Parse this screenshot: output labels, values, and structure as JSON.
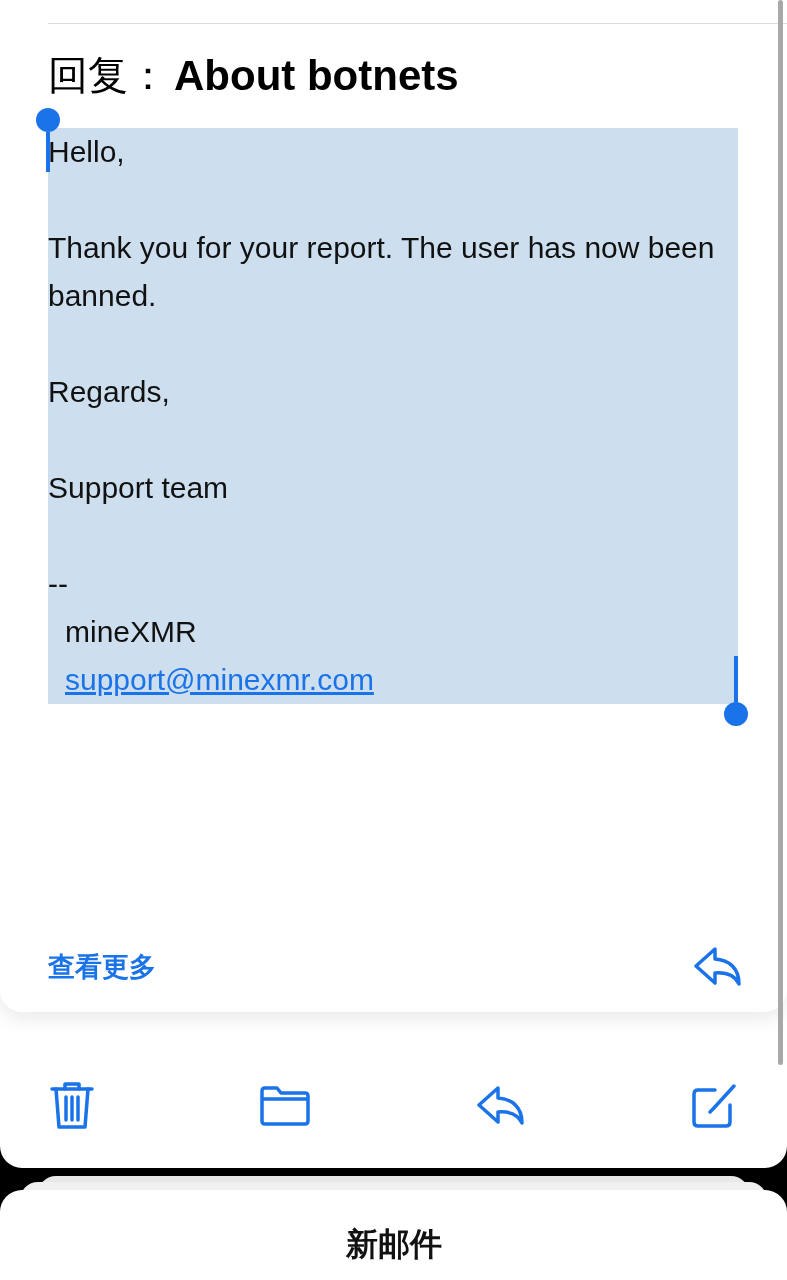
{
  "subject": {
    "prefix": "回复：",
    "title": "About botnets"
  },
  "body": {
    "selected": true,
    "paragraphs": [
      "Hello,",
      "Thank you for your report. The user has now been banned.",
      "Regards,",
      "Support team"
    ]
  },
  "signature": {
    "dash": "--",
    "name": "mineXMR",
    "email": "support@minexmr.com"
  },
  "see_more": "查看更多",
  "compose_sheet": {
    "title": "新邮件"
  }
}
